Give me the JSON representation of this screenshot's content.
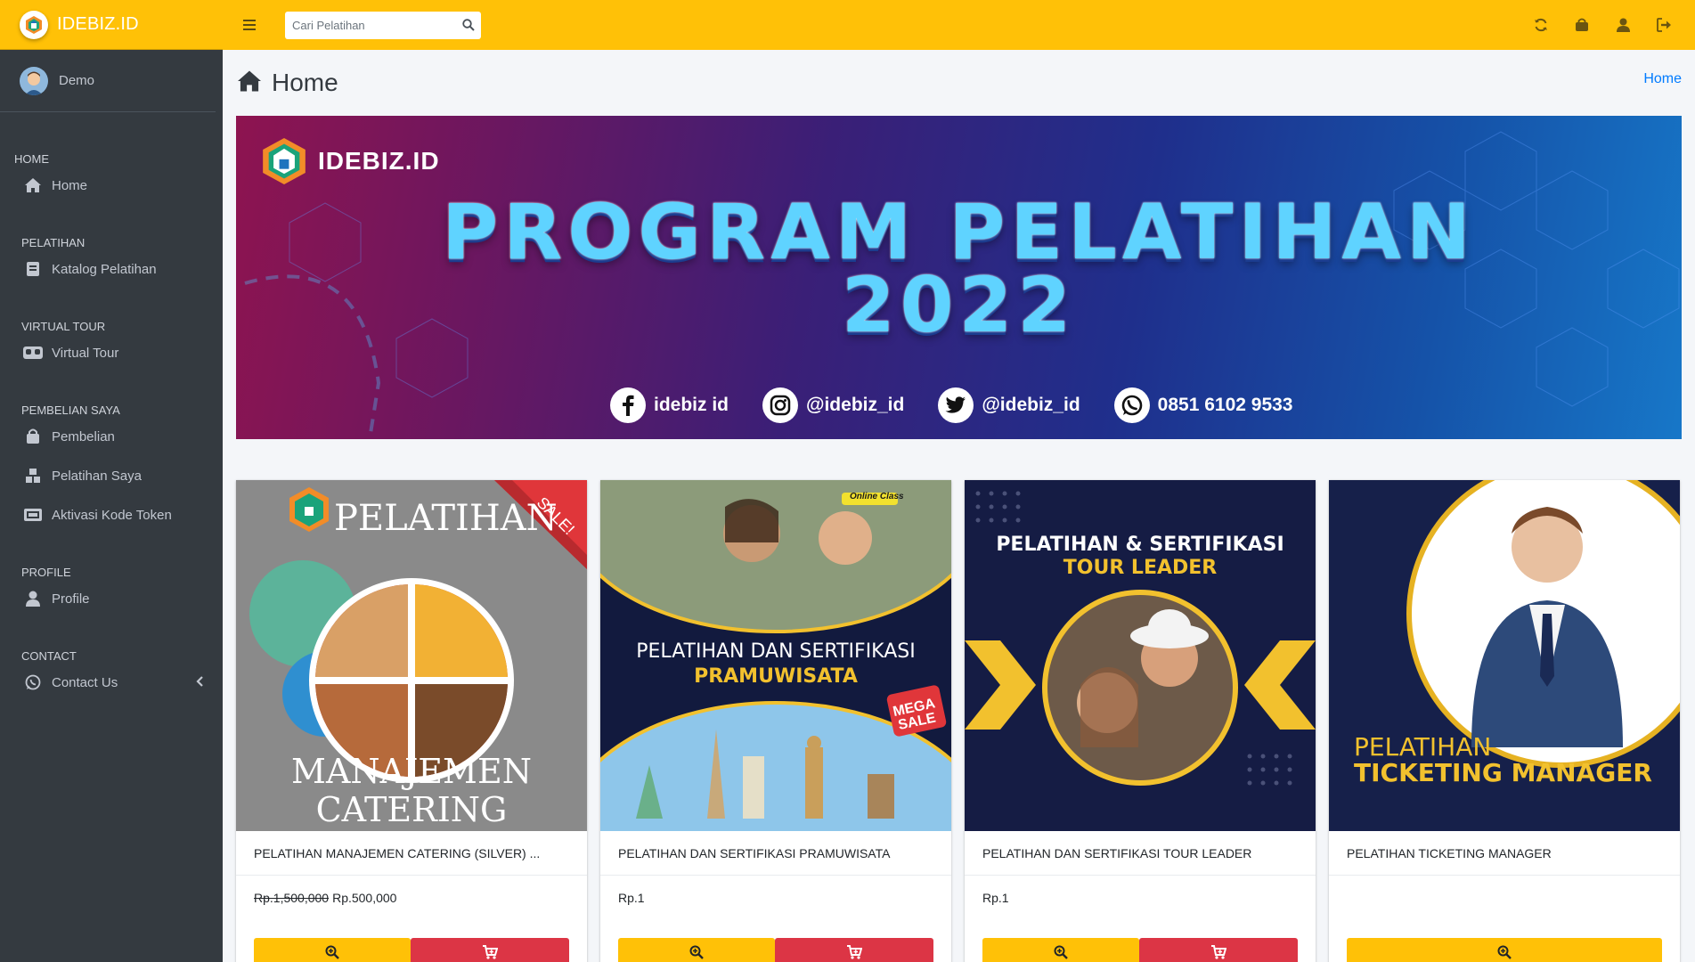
{
  "brand": {
    "name": "IDEBIZ.ID"
  },
  "user": {
    "name": "Demo"
  },
  "sidebar": {
    "sections": [
      {
        "header": "HOME",
        "items": [
          {
            "label": "Home",
            "icon": "home-icon"
          }
        ]
      },
      {
        "header": "PELATIHAN",
        "items": [
          {
            "label": "Katalog Pelatihan",
            "icon": "book-icon"
          }
        ]
      },
      {
        "header": "VIRTUAL TOUR",
        "items": [
          {
            "label": "Virtual Tour",
            "icon": "vr-headset-icon"
          }
        ]
      },
      {
        "header": "PEMBELIAN SAYA",
        "items": [
          {
            "label": "Pembelian",
            "icon": "shopping-bag-icon"
          },
          {
            "label": "Pelatihan Saya",
            "icon": "boxes-icon"
          },
          {
            "label": "Aktivasi Kode Token",
            "icon": "ticket-icon"
          }
        ]
      },
      {
        "header": "PROFILE",
        "items": [
          {
            "label": "Profile",
            "icon": "user-icon"
          }
        ]
      },
      {
        "header": "CONTACT",
        "items": [
          {
            "label": "Contact Us",
            "icon": "whatsapp-icon"
          }
        ]
      }
    ]
  },
  "search": {
    "placeholder": "Cari Pelatihan"
  },
  "page": {
    "title": "Home",
    "breadcrumb": "Home"
  },
  "banner": {
    "brand": "IDEBIZ.ID",
    "title_line1": "PROGRAM PELATIHAN",
    "title_line2": "2022",
    "socials": [
      {
        "icon": "facebook-icon",
        "text": "idebiz id"
      },
      {
        "icon": "instagram-icon",
        "text": "@idebiz_id"
      },
      {
        "icon": "twitter-icon",
        "text": "@idebiz_id"
      },
      {
        "icon": "whatsapp-icon",
        "text": "0851 6102 9533"
      }
    ]
  },
  "products": [
    {
      "title": "PELATIHAN MANAJEMEN CATERING (SILVER) ...",
      "old_price": "Rp.1,500,000",
      "price": "Rp.500,000",
      "ribbon": "SALE!",
      "image_text": {
        "top": "PELATIHAN",
        "bottom1": "MANAJEMEN",
        "bottom2": "CATERING"
      },
      "has_cart": true
    },
    {
      "title": "PELATIHAN DAN SERTIFIKASI PRAMUWISATA",
      "old_price": "",
      "price": "Rp.1",
      "image_text": {
        "badge": "Online Class",
        "line1": "PELATIHAN DAN SERTIFIKASI",
        "line2": "PRAMUWISATA",
        "sale1": "MEGA",
        "sale2": "SALE"
      },
      "has_cart": true
    },
    {
      "title": "PELATIHAN DAN SERTIFIKASI TOUR LEADER",
      "old_price": "",
      "price": "Rp.1",
      "image_text": {
        "line1": "PELATIHAN & SERTIFIKASI",
        "line2": "TOUR LEADER"
      },
      "has_cart": true
    },
    {
      "title": "PELATIHAN TICKETING MANAGER",
      "old_price": "",
      "price": "",
      "image_text": {
        "line1": "PELATIHAN",
        "line2": "TICKETING MANAGER"
      },
      "has_cart": false
    }
  ],
  "card_footer": {
    "fb": "idebiz id",
    "ig": "@idebiz_id",
    "tw": "@idebiz_id",
    "wa": "0851 6102 9533"
  },
  "colors": {
    "accent": "#ffc107",
    "sidebar": "#343a40",
    "danger": "#dc3545",
    "link": "#007bff"
  }
}
